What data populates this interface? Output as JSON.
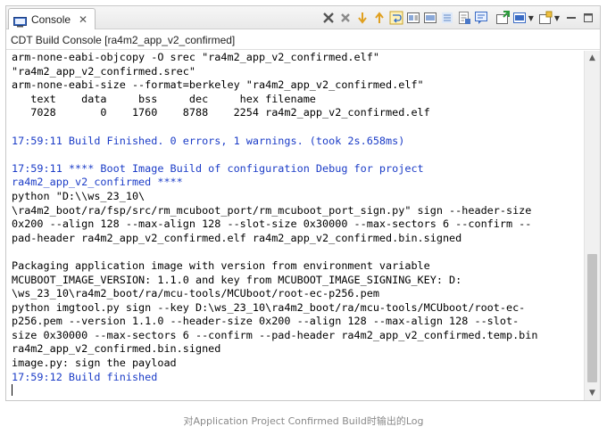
{
  "tab": {
    "label": "Console"
  },
  "console_title": "CDT Build Console [ra4m2_app_v2_confirmed]",
  "output_lines": [
    {
      "text": "arm-none-eabi-objcopy -O srec \"ra4m2_app_v2_confirmed.elf\"",
      "color": "black"
    },
    {
      "text": "\"ra4m2_app_v2_confirmed.srec\"",
      "color": "black"
    },
    {
      "text": "arm-none-eabi-size --format=berkeley \"ra4m2_app_v2_confirmed.elf\"",
      "color": "black"
    },
    {
      "text": "   text    data     bss     dec     hex filename",
      "color": "black"
    },
    {
      "text": "   7028       0    1760    8788    2254 ra4m2_app_v2_confirmed.elf",
      "color": "black"
    },
    {
      "text": "",
      "color": "black"
    },
    {
      "text": "17:59:11 Build Finished. 0 errors, 1 warnings. (took 2s.658ms)",
      "color": "blue"
    },
    {
      "text": "",
      "color": "black"
    },
    {
      "text": "17:59:11 **** Boot Image Build of configuration Debug for project",
      "color": "blue"
    },
    {
      "text": "ra4m2_app_v2_confirmed ****",
      "color": "blue"
    },
    {
      "text": "python \"D:\\\\ws_23_10\\",
      "color": "black"
    },
    {
      "text": "\\ra4m2_boot/ra/fsp/src/rm_mcuboot_port/rm_mcuboot_port_sign.py\" sign --header-size",
      "color": "black"
    },
    {
      "text": "0x200 --align 128 --max-align 128 --slot-size 0x30000 --max-sectors 6 --confirm --",
      "color": "black"
    },
    {
      "text": "pad-header ra4m2_app_v2_confirmed.elf ra4m2_app_v2_confirmed.bin.signed",
      "color": "black"
    },
    {
      "text": "",
      "color": "black"
    },
    {
      "text": "Packaging application image with version from environment variable",
      "color": "black"
    },
    {
      "text": "MCUBOOT_IMAGE_VERSION: 1.1.0 and key from MCUBOOT_IMAGE_SIGNING_KEY: D:",
      "color": "black"
    },
    {
      "text": "\\ws_23_10\\ra4m2_boot/ra/mcu-tools/MCUboot/root-ec-p256.pem",
      "color": "black"
    },
    {
      "text": "python imgtool.py sign --key D:\\ws_23_10\\ra4m2_boot/ra/mcu-tools/MCUboot/root-ec-",
      "color": "black"
    },
    {
      "text": "p256.pem --version 1.1.0 --header-size 0x200 --align 128 --max-align 128 --slot-",
      "color": "black"
    },
    {
      "text": "size 0x30000 --max-sectors 6 --confirm --pad-header ra4m2_app_v2_confirmed.temp.bin",
      "color": "black"
    },
    {
      "text": "ra4m2_app_v2_confirmed.bin.signed",
      "color": "black"
    },
    {
      "text": "image.py: sign the payload",
      "color": "black"
    },
    {
      "text": "17:59:12 Build finished",
      "color": "blue"
    }
  ],
  "colors": {
    "blue_text": "#1b3cc7",
    "scroll_thumb": "#c2c2c2"
  },
  "icons": [
    "console-icon",
    "close-icon",
    "clear-console-icon",
    "scroll-lock-down-icon",
    "scroll-lock-up-icon",
    "word-wrap-icon",
    "pin-icon",
    "show-on-output-icon",
    "display-selected-console-icon",
    "open-console-icon",
    "minimize-icon",
    "maximize-icon"
  ],
  "caption": "对Application Project Confirmed Build时输出的Log"
}
